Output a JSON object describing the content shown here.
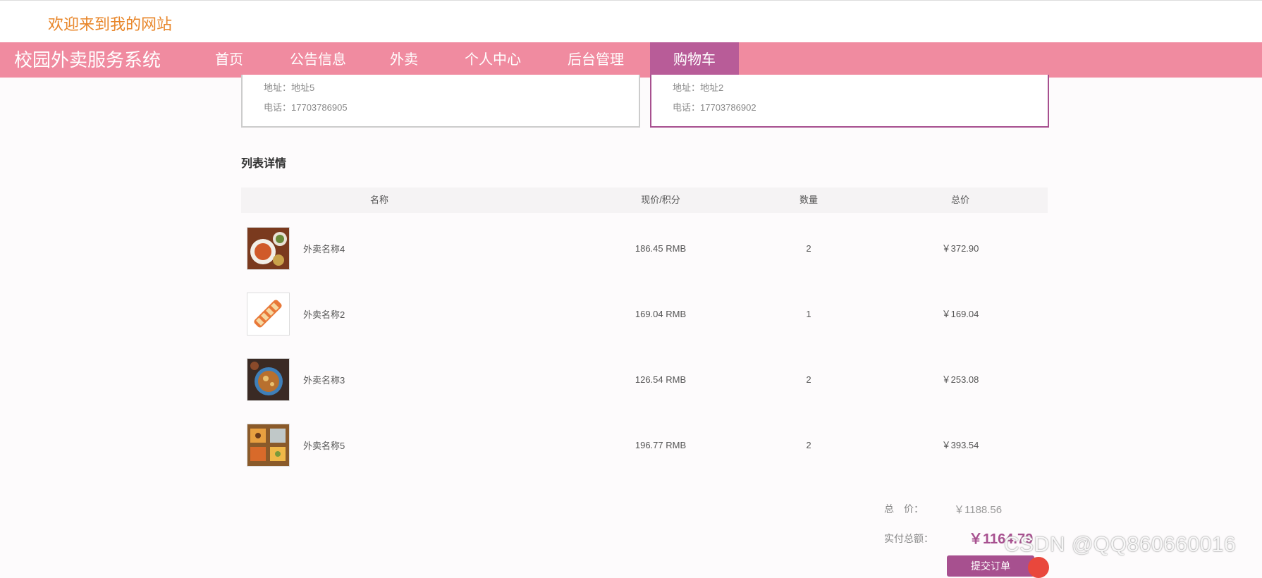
{
  "header": {
    "welcome": "欢迎来到我的网站"
  },
  "nav": {
    "brand": "校园外卖服务系统",
    "items": [
      {
        "label": "首页"
      },
      {
        "label": "公告信息"
      },
      {
        "label": "外卖"
      },
      {
        "label": "个人中心"
      },
      {
        "label": "后台管理"
      },
      {
        "label": "购物车"
      }
    ]
  },
  "addresses": [
    {
      "address_label": "地址：",
      "address": "地址5",
      "phone_label": "电话：",
      "phone": "17703786905",
      "selected": false
    },
    {
      "address_label": "地址：",
      "address": "地址2",
      "phone_label": "电话：",
      "phone": "17703786902",
      "selected": true
    }
  ],
  "list": {
    "title": "列表详情",
    "headers": [
      "名称",
      "现价/积分",
      "数量",
      "总价"
    ],
    "rows": [
      {
        "name": "外卖名称4",
        "price": "186.45 RMB",
        "qty": "2",
        "total": "￥372.90",
        "image": "food-dish-icon"
      },
      {
        "name": "外卖名称2",
        "price": "169.04 RMB",
        "qty": "1",
        "total": "￥169.04",
        "image": "sushi-roll-icon"
      },
      {
        "name": "外卖名称3",
        "price": "126.54 RMB",
        "qty": "2",
        "total": "￥253.08",
        "image": "noodle-bowl-icon"
      },
      {
        "name": "外卖名称5",
        "price": "196.77 RMB",
        "qty": "2",
        "total": "￥393.54",
        "image": "food-platter-icon"
      }
    ]
  },
  "summary": {
    "total_label": "总　价：",
    "total_value": "￥1188.56",
    "pay_label": "实付总额：",
    "pay_value": "￥1164.79",
    "submit_label": "提交订单"
  },
  "watermark": "CSDN @QQ860660016",
  "colors": {
    "nav": "#f08ba0",
    "active": "#b85c98",
    "accent": "#a7508f",
    "welcome": "#e8862a"
  }
}
